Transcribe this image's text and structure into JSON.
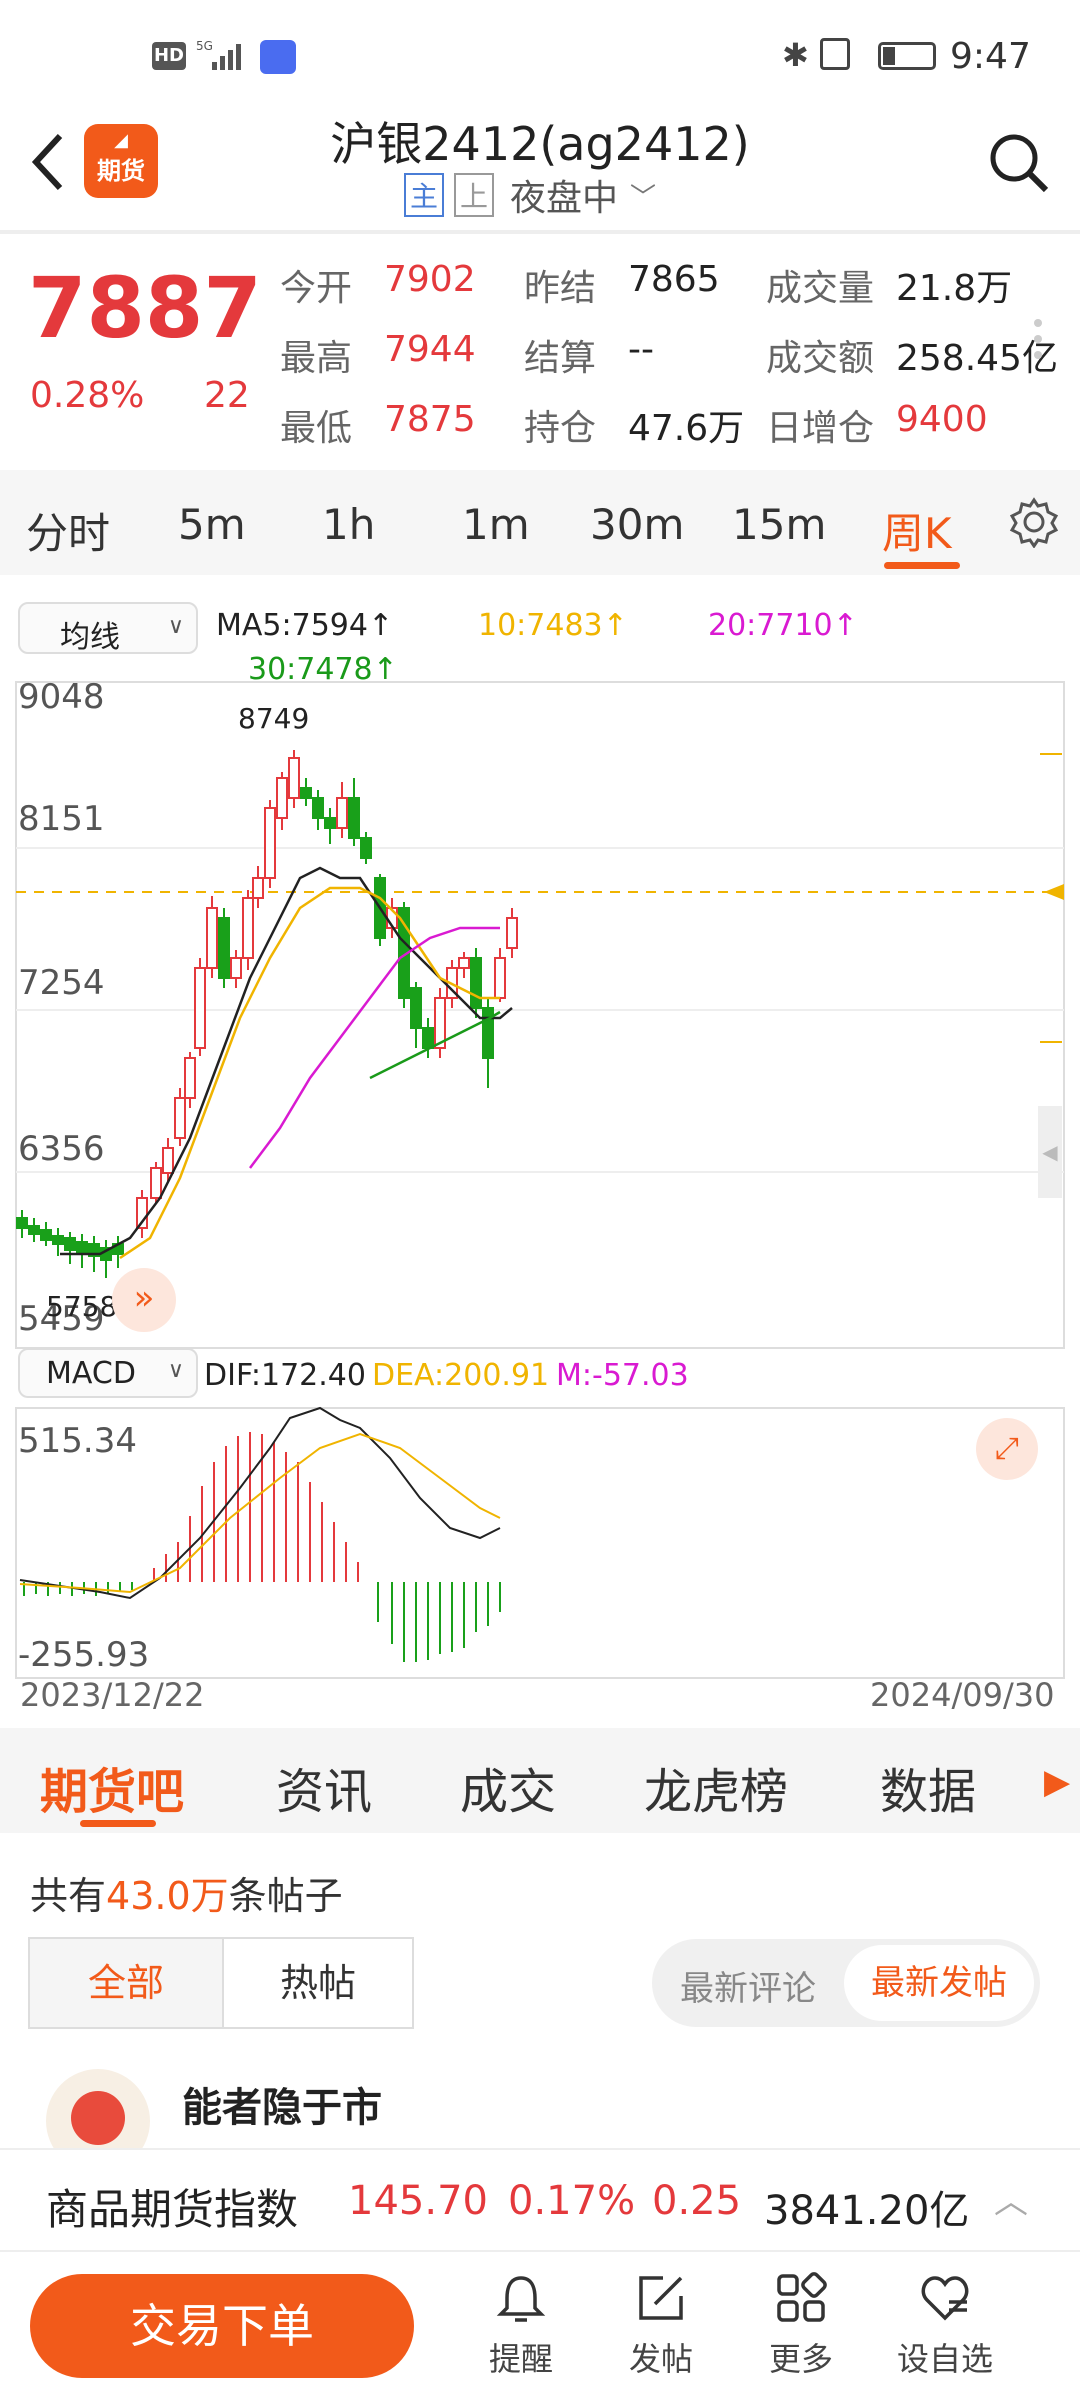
{
  "status": {
    "left_icons": [
      "HD",
      "5G"
    ],
    "time": "9:47"
  },
  "header": {
    "logo_text": "期货",
    "title": "沪银2412(ag2412)",
    "tag_main": "主",
    "tag_up": "上",
    "session": "夜盘中"
  },
  "quote": {
    "price": "7887",
    "change_pct": "0.28%",
    "change": "22",
    "rows": [
      [
        {
          "label": "今开",
          "value": "7902",
          "color": "red"
        },
        {
          "label": "昨结",
          "value": "7865",
          "color": "normal"
        },
        {
          "label": "成交量",
          "value": "21.8万",
          "color": "normal"
        }
      ],
      [
        {
          "label": "最高",
          "value": "7944",
          "color": "red"
        },
        {
          "label": "结算",
          "value": "--",
          "color": "normal"
        },
        {
          "label": "成交额",
          "value": "258.45亿",
          "color": "normal"
        }
      ],
      [
        {
          "label": "最低",
          "value": "7875",
          "color": "red"
        },
        {
          "label": "持仓",
          "value": "47.6万",
          "color": "normal"
        },
        {
          "label": "日增仓",
          "value": "9400",
          "color": "red"
        }
      ]
    ]
  },
  "period_tabs": [
    "分时",
    "5m",
    "1h",
    "1m",
    "30m",
    "15m",
    "周K"
  ],
  "period_active": "周K",
  "ma_selector": "均线",
  "ma": {
    "ma5": "MA5:7594",
    "ma10": "10:7483",
    "ma20": "20:7710",
    "ma30": "30:7478"
  },
  "colors": {
    "ma5": "#222222",
    "ma10": "#f0b400",
    "ma20": "#d91ad1",
    "ma30": "#1a9a1a",
    "up": "#e4393c",
    "down": "#19a01a",
    "accent": "#f25a1a"
  },
  "kline_axis": {
    "labels": [
      "9048",
      "8151",
      "7254",
      "6356",
      "5459"
    ],
    "max_label": "8749",
    "min_label": "5758"
  },
  "macd_selector": "MACD",
  "macd": {
    "dif": "DIF:172.40",
    "dea": "DEA:200.91",
    "m": "M:-57.03",
    "top": "515.34",
    "bottom": "-255.93"
  },
  "dates": {
    "start": "2023/12/22",
    "end": "2024/09/30"
  },
  "tabs2": [
    "期货吧",
    "资讯",
    "成交",
    "龙虎榜",
    "数据"
  ],
  "posts": {
    "count_prefix": "共有",
    "count": "43.0万",
    "count_suffix": "条帖子",
    "filter_all": "全部",
    "filter_hot": "热帖",
    "sort_comment": "最新评论",
    "sort_post": "最新发帖",
    "first_author": "能者隐于市"
  },
  "index_bar": {
    "name": "商品期货指数",
    "value": "145.70",
    "pct": "0.17%",
    "change": "0.25",
    "amount": "3841.20亿"
  },
  "bottom": {
    "trade": "交易下单",
    "icons": [
      {
        "name": "bell-icon",
        "label": "提醒"
      },
      {
        "name": "edit-icon",
        "label": "发帖"
      },
      {
        "name": "grid-icon",
        "label": "更多"
      },
      {
        "name": "heart-icon",
        "label": "设自选"
      }
    ]
  }
}
